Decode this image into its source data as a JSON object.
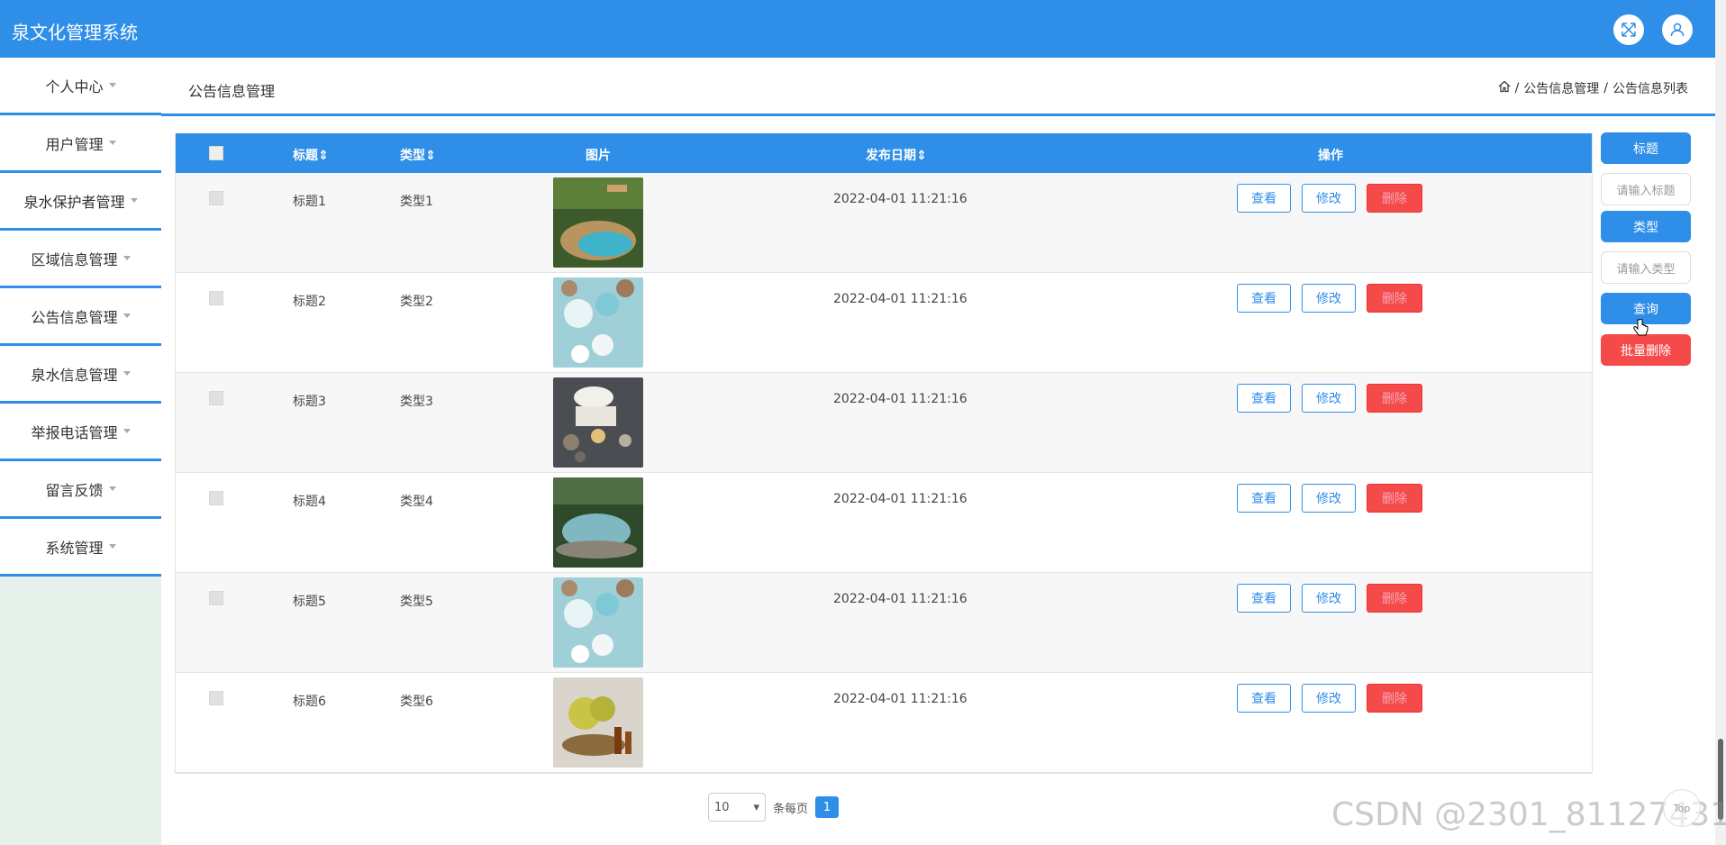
{
  "app": {
    "title": "泉文化管理系统"
  },
  "header": {
    "icons": [
      "fullscreen-icon",
      "user-icon"
    ]
  },
  "sidebar": {
    "items": [
      {
        "label": "个人中心"
      },
      {
        "label": "用户管理"
      },
      {
        "label": "泉水保护者管理"
      },
      {
        "label": "区域信息管理"
      },
      {
        "label": "公告信息管理"
      },
      {
        "label": "泉水信息管理"
      },
      {
        "label": "举报电话管理"
      },
      {
        "label": "留言反馈"
      },
      {
        "label": "系统管理"
      }
    ]
  },
  "breadcrumb": {
    "page_title": "公告信息管理",
    "path": [
      "公告信息管理",
      "公告信息列表"
    ],
    "separator": "/"
  },
  "table": {
    "columns": {
      "title": "标题",
      "type": "类型",
      "image": "图片",
      "date": "发布日期",
      "actions": "操作"
    },
    "actions": {
      "view": "查看",
      "edit": "修改",
      "delete": "删除"
    },
    "rows": [
      {
        "title": "标题1",
        "type": "类型1",
        "date": "2022-04-01 11:21:16",
        "image": "pool-photo"
      },
      {
        "title": "标题2",
        "type": "类型2",
        "date": "2022-04-01 11:21:16",
        "image": "candles-photo"
      },
      {
        "title": "标题3",
        "type": "类型3",
        "date": "2022-04-01 11:21:16",
        "image": "spa-towels-photo"
      },
      {
        "title": "标题4",
        "type": "类型4",
        "date": "2022-04-01 11:21:16",
        "image": "garden-pool-photo"
      },
      {
        "title": "标题5",
        "type": "类型5",
        "date": "2022-04-01 11:21:16",
        "image": "candles-photo"
      },
      {
        "title": "标题6",
        "type": "类型6",
        "date": "2022-04-01 11:21:16",
        "image": "flowers-oil-photo"
      }
    ]
  },
  "search": {
    "title_label": "标题",
    "title_placeholder": "请输入标题",
    "type_label": "类型",
    "type_placeholder": "请输入类型",
    "query_button": "查询",
    "batch_delete_button": "批量删除"
  },
  "pagination": {
    "page_size": "10",
    "per_page_label": "条每页",
    "current_page": "1"
  },
  "colors": {
    "primary": "#2e8ee8",
    "danger": "#f44a4a",
    "sidebar_bg": "#e7f1ec"
  },
  "watermark": "CSDN @2301_81127431",
  "back_to_top": "Top"
}
